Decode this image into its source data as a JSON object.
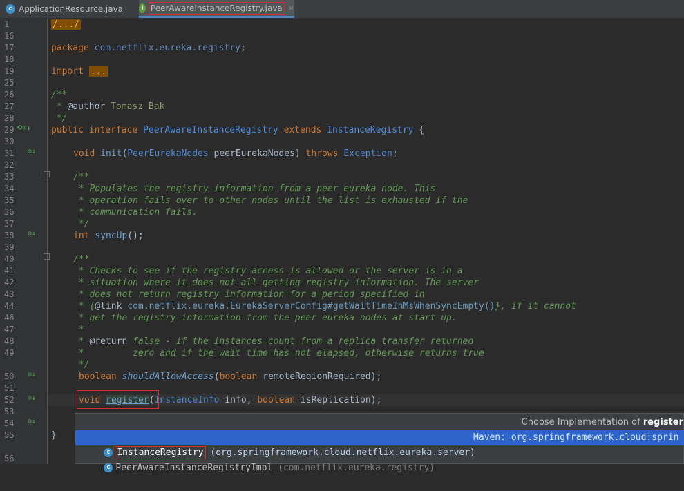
{
  "tabs": [
    {
      "label": "ApplicationResource.java",
      "icon": "class-icon",
      "active": false
    },
    {
      "label": "PeerAwareInstanceRegistry.java",
      "icon": "interface-icon",
      "active": true,
      "close": "×"
    }
  ],
  "lines": [
    {
      "n": "1"
    },
    {
      "n": "16"
    },
    {
      "n": "17"
    },
    {
      "n": "18"
    },
    {
      "n": "19"
    },
    {
      "n": "25"
    },
    {
      "n": "26"
    },
    {
      "n": "27"
    },
    {
      "n": "28"
    },
    {
      "n": "29"
    },
    {
      "n": "30"
    },
    {
      "n": "31"
    },
    {
      "n": "32"
    },
    {
      "n": "33"
    },
    {
      "n": "34"
    },
    {
      "n": "35"
    },
    {
      "n": "36"
    },
    {
      "n": "37"
    },
    {
      "n": "38"
    },
    {
      "n": "39"
    },
    {
      "n": "40"
    },
    {
      "n": "41"
    },
    {
      "n": "42"
    },
    {
      "n": "43"
    },
    {
      "n": "44"
    },
    {
      "n": "46"
    },
    {
      "n": "47"
    },
    {
      "n": "48"
    },
    {
      "n": "49"
    },
    {
      "n": "50"
    },
    {
      "n": "51"
    },
    {
      "n": "52"
    },
    {
      "n": "53"
    },
    {
      "n": "54"
    },
    {
      "n": "55"
    },
    {
      "n": "56"
    }
  ],
  "code": {
    "l1_fold": "/.../",
    "l17_kw": "package",
    "l17_pkg": "com.netflix.eureka.registry",
    "l17_end": ";",
    "l19_kw": "import",
    "l19_fold": "...",
    "l26": "/**",
    "l27_pre": " * ",
    "l27_tag": "@author",
    "l27_val": " Tomasz Bak",
    "l28": " */",
    "l29_kw1": "public interface",
    "l29_name": "PeerAwareInstanceRegistry",
    "l29_kw2": "extends",
    "l29_super": "InstanceRegistry",
    "l29_end": " {",
    "l31_kw": "void",
    "l31_name": "init",
    "l31_open": "(",
    "l31_type": "PeerEurekaNodes",
    "l31_arg": " peerEurekaNodes) ",
    "l31_kw2": "throws",
    "l31_exc": "Exception",
    "l31_end": ";",
    "l33": "/**",
    "l34": " * Populates the registry information from a peer eureka node. This",
    "l35": " * operation fails over to other nodes until the list is exhausted if the",
    "l36": " * communication fails.",
    "l37": " */",
    "l38_kw": "int",
    "l38_name": "syncUp",
    "l38_end": "();",
    "l40": "/**",
    "l41": " * Checks to see if the registry access is allowed or the server is in a",
    "l42": " * situation where it does not all getting registry information. The server",
    "l43": " * does not return registry information for a period specified in",
    "l44_pre": " * {",
    "l44_tag": "@link",
    "l44_link": " com.netflix.eureka.EurekaServerConfig#getWaitTimeInMsWhenSyncEmpty()",
    "l44_end": "}, if it cannot",
    "l46": " * get the registry information from the peer eureka nodes at start up.",
    "l47": " *",
    "l48_pre": " * ",
    "l48_tag": "@return",
    "l48_val": " false - if the instances count from a replica transfer returned",
    "l49": " *         zero and if the wait time has not elapsed, otherwise returns true",
    "l50c": " */",
    "l50_kw": "boolean",
    "l50_name": "shouldAllowAccess",
    "l50_open": "(",
    "l50_kw2": "boolean",
    "l50_end": " remoteRegionRequired);",
    "l52_kw": "void",
    "l52_name": "register",
    "l52_open": "(",
    "l52_type": "InstanceInfo",
    "l52_mid": " info, ",
    "l52_kw2": "boolean",
    "l52_end": " isReplication);",
    "l55_brace": "}"
  },
  "popup": {
    "title_pre": "Choose Implementation of ",
    "title_method": "register",
    "items": [
      {
        "name": "InstanceRegistry",
        "pkg": " (org.springframework.cloud.netflix.eureka.server)",
        "maven": "Maven: org.springframework.cloud:sprin",
        "selected": true
      },
      {
        "name": "PeerAwareInstanceRegistryImpl",
        "pkg": " (com.netflix.eureka.registry)",
        "selected": false
      }
    ]
  }
}
